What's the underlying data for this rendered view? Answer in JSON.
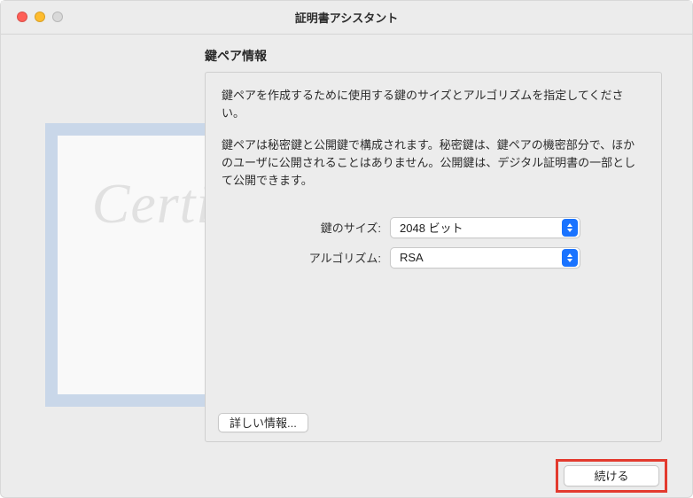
{
  "window": {
    "title": "証明書アシスタント"
  },
  "header": {
    "heading": "鍵ペア情報"
  },
  "panel": {
    "intro": "鍵ペアを作成するために使用する鍵のサイズとアルゴリズムを指定してください。",
    "description": "鍵ペアは秘密鍵と公開鍵で構成されます。秘密鍵は、鍵ペアの機密部分で、ほかのユーザに公開されることはありません。公開鍵は、デジタル証明書の一部として公開できます。"
  },
  "form": {
    "key_size_label": "鍵のサイズ:",
    "key_size_value": "2048 ビット",
    "algorithm_label": "アルゴリズム:",
    "algorithm_value": "RSA"
  },
  "buttons": {
    "more_info": "詳しい情報...",
    "continue": "続ける"
  },
  "decor": {
    "certificate_word": "Certificate"
  }
}
